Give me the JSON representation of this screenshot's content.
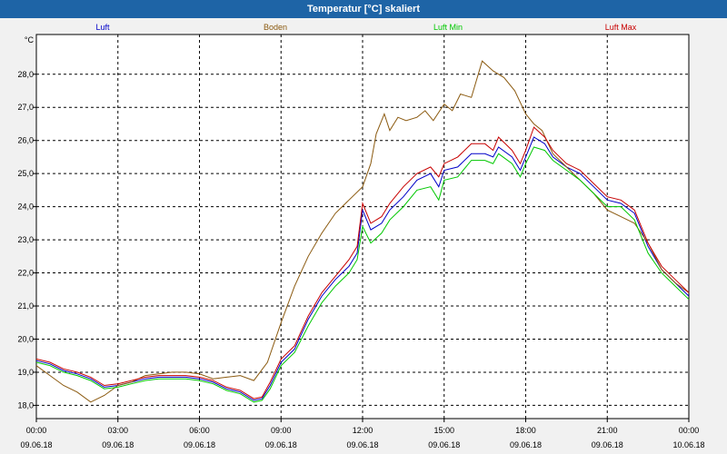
{
  "window": {
    "title": "Temperatur [°C] skaliert"
  },
  "chart_data": {
    "type": "line",
    "title": "Temperatur [°C] skaliert",
    "ylabel": "°C",
    "xlabel": "",
    "ylim": [
      17.6,
      29.2
    ],
    "xlim": [
      0,
      24
    ],
    "y_ticks": [
      "28,0",
      "27,0",
      "26,0",
      "25,0",
      "24,0",
      "23,0",
      "22,0",
      "21,0",
      "20,0",
      "19,0",
      "18,0"
    ],
    "y_tick_values": [
      28,
      27,
      26,
      25,
      24,
      23,
      22,
      21,
      20,
      19,
      18
    ],
    "x_tick_values": [
      0,
      3,
      6,
      9,
      12,
      15,
      18,
      21,
      24
    ],
    "x_ticks_time": [
      "00:00",
      "03:00",
      "06:00",
      "09:00",
      "12:00",
      "15:00",
      "18:00",
      "21:00",
      "00:00"
    ],
    "x_ticks_date": [
      "09.06.18",
      "09.06.18",
      "09.06.18",
      "09.06.18",
      "09.06.18",
      "09.06.18",
      "09.06.18",
      "09.06.18",
      "10.06.18"
    ],
    "grid": true,
    "legend_position": "top",
    "series": [
      {
        "name": "Luft",
        "color": "#0000c8",
        "points": [
          [
            0,
            19.35
          ],
          [
            0.5,
            19.25
          ],
          [
            1,
            19.05
          ],
          [
            1.5,
            18.95
          ],
          [
            2,
            18.8
          ],
          [
            2.5,
            18.55
          ],
          [
            3,
            18.6
          ],
          [
            3.5,
            18.7
          ],
          [
            4,
            18.8
          ],
          [
            4.5,
            18.85
          ],
          [
            5,
            18.85
          ],
          [
            5.5,
            18.85
          ],
          [
            6,
            18.8
          ],
          [
            6.5,
            18.7
          ],
          [
            7,
            18.5
          ],
          [
            7.5,
            18.4
          ],
          [
            8,
            18.15
          ],
          [
            8.3,
            18.2
          ],
          [
            8.6,
            18.6
          ],
          [
            9,
            19.3
          ],
          [
            9.5,
            19.7
          ],
          [
            10,
            20.6
          ],
          [
            10.5,
            21.3
          ],
          [
            11,
            21.8
          ],
          [
            11.5,
            22.2
          ],
          [
            11.8,
            22.6
          ],
          [
            12,
            23.9
          ],
          [
            12.3,
            23.3
          ],
          [
            12.7,
            23.5
          ],
          [
            13,
            23.9
          ],
          [
            13.5,
            24.3
          ],
          [
            14,
            24.8
          ],
          [
            14.5,
            25
          ],
          [
            14.8,
            24.6
          ],
          [
            15,
            25.1
          ],
          [
            15.5,
            25.2
          ],
          [
            16,
            25.6
          ],
          [
            16.5,
            25.6
          ],
          [
            16.8,
            25.5
          ],
          [
            17,
            25.8
          ],
          [
            17.5,
            25.5
          ],
          [
            17.8,
            25.1
          ],
          [
            18,
            25.5
          ],
          [
            18.3,
            26.1
          ],
          [
            18.7,
            25.9
          ],
          [
            19,
            25.5
          ],
          [
            19.5,
            25.2
          ],
          [
            20,
            25
          ],
          [
            20.5,
            24.6
          ],
          [
            21,
            24.2
          ],
          [
            21.5,
            24.1
          ],
          [
            22,
            23.8
          ],
          [
            22.5,
            22.8
          ],
          [
            23,
            22.1
          ],
          [
            23.5,
            21.7
          ],
          [
            24,
            21.3
          ]
        ]
      },
      {
        "name": "Boden",
        "color": "#8b5a10",
        "points": [
          [
            0,
            19.2
          ],
          [
            0.5,
            18.9
          ],
          [
            1,
            18.6
          ],
          [
            1.5,
            18.4
          ],
          [
            2,
            18.1
          ],
          [
            2.5,
            18.3
          ],
          [
            3,
            18.6
          ],
          [
            3.5,
            18.7
          ],
          [
            4,
            18.9
          ],
          [
            4.5,
            18.95
          ],
          [
            5,
            19
          ],
          [
            5.5,
            19
          ],
          [
            6,
            18.95
          ],
          [
            6.5,
            18.8
          ],
          [
            7,
            18.85
          ],
          [
            7.5,
            18.9
          ],
          [
            8,
            18.75
          ],
          [
            8.5,
            19.3
          ],
          [
            9,
            20.5
          ],
          [
            9.5,
            21.6
          ],
          [
            10,
            22.5
          ],
          [
            10.5,
            23.2
          ],
          [
            11,
            23.8
          ],
          [
            11.5,
            24.2
          ],
          [
            12,
            24.6
          ],
          [
            12.3,
            25.3
          ],
          [
            12.5,
            26.2
          ],
          [
            12.8,
            26.8
          ],
          [
            13,
            26.3
          ],
          [
            13.3,
            26.7
          ],
          [
            13.6,
            26.6
          ],
          [
            14,
            26.7
          ],
          [
            14.3,
            26.9
          ],
          [
            14.6,
            26.6
          ],
          [
            15,
            27.1
          ],
          [
            15.3,
            26.9
          ],
          [
            15.6,
            27.4
          ],
          [
            16,
            27.3
          ],
          [
            16.4,
            28.4
          ],
          [
            16.8,
            28.1
          ],
          [
            17.2,
            27.9
          ],
          [
            17.6,
            27.5
          ],
          [
            18,
            26.8
          ],
          [
            18.3,
            26.5
          ],
          [
            18.6,
            26.3
          ],
          [
            19,
            25.6
          ],
          [
            19.5,
            25.2
          ],
          [
            20,
            24.8
          ],
          [
            20.5,
            24.4
          ],
          [
            21,
            23.9
          ],
          [
            21.5,
            23.7
          ],
          [
            22,
            23.5
          ],
          [
            22.5,
            22.9
          ],
          [
            23,
            22.1
          ],
          [
            23.5,
            21.7
          ],
          [
            24,
            21.4
          ]
        ]
      },
      {
        "name": "Luft Min",
        "color": "#00c800",
        "points": [
          [
            0,
            19.3
          ],
          [
            0.5,
            19.2
          ],
          [
            1,
            19
          ],
          [
            1.5,
            18.9
          ],
          [
            2,
            18.75
          ],
          [
            2.5,
            18.5
          ],
          [
            3,
            18.55
          ],
          [
            3.5,
            18.65
          ],
          [
            4,
            18.75
          ],
          [
            4.5,
            18.8
          ],
          [
            5,
            18.8
          ],
          [
            5.5,
            18.8
          ],
          [
            6,
            18.75
          ],
          [
            6.5,
            18.65
          ],
          [
            7,
            18.45
          ],
          [
            7.5,
            18.35
          ],
          [
            8,
            18.1
          ],
          [
            8.3,
            18.15
          ],
          [
            8.6,
            18.5
          ],
          [
            9,
            19.2
          ],
          [
            9.5,
            19.6
          ],
          [
            10,
            20.4
          ],
          [
            10.5,
            21.1
          ],
          [
            11,
            21.6
          ],
          [
            11.5,
            22
          ],
          [
            11.8,
            22.4
          ],
          [
            12,
            23.4
          ],
          [
            12.3,
            22.9
          ],
          [
            12.7,
            23.2
          ],
          [
            13,
            23.6
          ],
          [
            13.5,
            24
          ],
          [
            14,
            24.5
          ],
          [
            14.5,
            24.6
          ],
          [
            14.8,
            24.2
          ],
          [
            15,
            24.8
          ],
          [
            15.5,
            24.9
          ],
          [
            16,
            25.4
          ],
          [
            16.5,
            25.4
          ],
          [
            16.8,
            25.3
          ],
          [
            17,
            25.6
          ],
          [
            17.5,
            25.3
          ],
          [
            17.8,
            24.9
          ],
          [
            18,
            25.3
          ],
          [
            18.3,
            25.8
          ],
          [
            18.7,
            25.7
          ],
          [
            19,
            25.4
          ],
          [
            19.5,
            25.1
          ],
          [
            20,
            24.8
          ],
          [
            20.5,
            24.4
          ],
          [
            21,
            24
          ],
          [
            21.5,
            24
          ],
          [
            22,
            23.6
          ],
          [
            22.5,
            22.6
          ],
          [
            23,
            22
          ],
          [
            23.5,
            21.6
          ],
          [
            24,
            21.2
          ]
        ]
      },
      {
        "name": "Luft Max",
        "color": "#c80000",
        "points": [
          [
            0,
            19.4
          ],
          [
            0.5,
            19.3
          ],
          [
            1,
            19.1
          ],
          [
            1.5,
            19
          ],
          [
            2,
            18.85
          ],
          [
            2.5,
            18.6
          ],
          [
            3,
            18.65
          ],
          [
            3.5,
            18.75
          ],
          [
            4,
            18.85
          ],
          [
            4.5,
            18.9
          ],
          [
            5,
            18.9
          ],
          [
            5.5,
            18.9
          ],
          [
            6,
            18.85
          ],
          [
            6.5,
            18.75
          ],
          [
            7,
            18.55
          ],
          [
            7.5,
            18.45
          ],
          [
            8,
            18.2
          ],
          [
            8.3,
            18.25
          ],
          [
            8.6,
            18.7
          ],
          [
            9,
            19.4
          ],
          [
            9.5,
            19.8
          ],
          [
            10,
            20.7
          ],
          [
            10.5,
            21.4
          ],
          [
            11,
            21.9
          ],
          [
            11.5,
            22.4
          ],
          [
            11.8,
            22.8
          ],
          [
            12,
            24.1
          ],
          [
            12.3,
            23.5
          ],
          [
            12.7,
            23.7
          ],
          [
            13,
            24.1
          ],
          [
            13.5,
            24.6
          ],
          [
            14,
            25
          ],
          [
            14.5,
            25.2
          ],
          [
            14.8,
            24.9
          ],
          [
            15,
            25.3
          ],
          [
            15.5,
            25.5
          ],
          [
            16,
            25.9
          ],
          [
            16.5,
            25.9
          ],
          [
            16.8,
            25.7
          ],
          [
            17,
            26.1
          ],
          [
            17.5,
            25.7
          ],
          [
            17.8,
            25.3
          ],
          [
            18,
            25.7
          ],
          [
            18.3,
            26.4
          ],
          [
            18.7,
            26.1
          ],
          [
            19,
            25.7
          ],
          [
            19.5,
            25.3
          ],
          [
            20,
            25.1
          ],
          [
            20.5,
            24.7
          ],
          [
            21,
            24.3
          ],
          [
            21.5,
            24.2
          ],
          [
            22,
            23.9
          ],
          [
            22.5,
            22.9
          ],
          [
            23,
            22.2
          ],
          [
            23.5,
            21.8
          ],
          [
            24,
            21.4
          ]
        ]
      }
    ]
  }
}
